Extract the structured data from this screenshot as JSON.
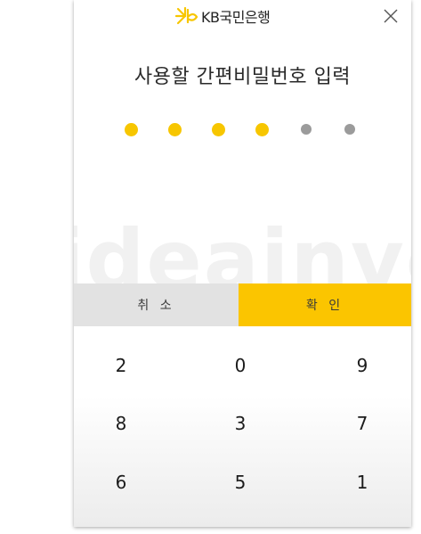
{
  "header": {
    "brand_text": "KB국민은행",
    "close_glyph": "✕",
    "logo_icon": "kb-star-logo-icon",
    "brand_color": "#f7c600"
  },
  "title": "사용할 간편비밀번호 입력",
  "pin": {
    "length": 6,
    "entered": 4,
    "filled_color": "#f7c600",
    "empty_color": "#9b9b9b"
  },
  "watermark_text": "ideainvest",
  "actions": {
    "cancel_label": "취 소",
    "confirm_label": "확 인",
    "cancel_color": "#e2e2e2",
    "confirm_color": "#fbc500"
  },
  "keypad": {
    "rows": [
      [
        "2",
        "0",
        "9"
      ],
      [
        "8",
        "3",
        "7"
      ],
      [
        "6",
        "5",
        "1"
      ]
    ]
  }
}
